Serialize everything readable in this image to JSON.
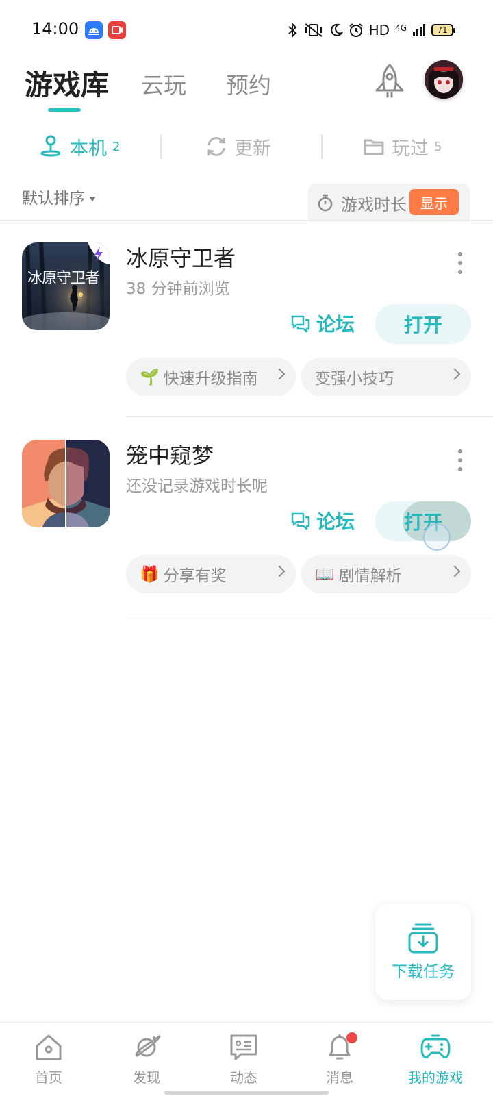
{
  "status_bar": {
    "time": "14:00",
    "network": "HD",
    "signal": "4G",
    "battery": "71"
  },
  "top_tabs": [
    "游戏库",
    "云玩",
    "预约"
  ],
  "sub_tabs": [
    {
      "label": "本机",
      "count": "2"
    },
    {
      "label": "更新",
      "count": ""
    },
    {
      "label": "玩过",
      "count": "5"
    }
  ],
  "sort": {
    "label": "默认排序",
    "time_label": "游戏时长",
    "show_label": "显示"
  },
  "games": [
    {
      "title": "冰原守卫者",
      "cover_text": "冰原守卫者",
      "subtitle": "38  分钟前浏览",
      "forum_label": "论坛",
      "open_label": "打开",
      "tips": [
        {
          "emoji": "🌱",
          "label": "快速升级指南"
        },
        {
          "emoji": "",
          "label": "变强小技巧"
        }
      ]
    },
    {
      "title": "笼中窥梦",
      "cover_text": "",
      "subtitle": "还没记录游戏时长呢",
      "forum_label": "论坛",
      "open_label": "打开",
      "tips": [
        {
          "emoji": "🎁",
          "label": "分享有奖"
        },
        {
          "emoji": "📖",
          "label": "剧情解析"
        }
      ]
    }
  ],
  "download_task": {
    "label": "下载任务"
  },
  "bottom_nav": [
    {
      "label": "首页",
      "icon": "home-icon"
    },
    {
      "label": "发现",
      "icon": "planet-icon"
    },
    {
      "label": "动态",
      "icon": "chat-card-icon"
    },
    {
      "label": "消息",
      "icon": "bell-icon"
    },
    {
      "label": "我的游戏",
      "icon": "gamepad-icon"
    }
  ],
  "colors": {
    "accent": "#27b9bd",
    "show_button": "#ff7a45",
    "badge": "#f04848"
  }
}
